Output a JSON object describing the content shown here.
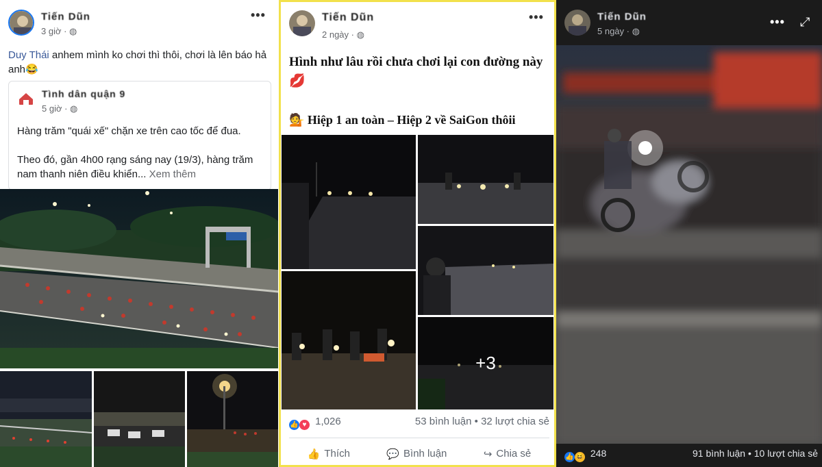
{
  "post1": {
    "author": "Tiến Dũn",
    "time": "3 giờ · ",
    "more": "•••",
    "mention": "Duy Thái",
    "text": " anhem mình ko chơi thì thôi, chơi là lên báo hả anh😂",
    "shared": {
      "author": "Tình dân quận 9",
      "time": "5 giờ · ",
      "headline": "Hàng trăm \"quái xế\" chặn xe trên cao tốc để đua.",
      "body": "Theo đó, gần 4h00 rạng sáng nay (19/3), hàng trăm nam thanh niên điều khiển...",
      "see_more": "Xem thêm"
    }
  },
  "post2": {
    "author": "Tiến Dũn",
    "time": "2 ngày · ",
    "more": "•••",
    "caption_line1": "Hình như lâu rồi chưa chơi lại con đường này 💋",
    "caption_line2": "💁 Hiệp 1 an toàn – Hiệp 2 về SaiGon thôii",
    "more_photos": "+3",
    "reaction_count": "1,026",
    "comments_shares": "53 bình luận • 32 lượt chia sẻ",
    "actions": {
      "like": "Thích",
      "comment": "Bình luận",
      "share": "Chia sẻ"
    }
  },
  "post3": {
    "author": "Tiến Dũn",
    "time": "5 ngày · ",
    "more": "•••",
    "expand": "⤢",
    "reaction_count": "248",
    "comments_shares": "91 bình luận • 10 lượt chia sẻ"
  },
  "colors": {
    "facebook_blue": "#1877f2",
    "mention": "#385898",
    "highlight_border": "#f2e14c",
    "dark_bg": "#1b1b1b"
  }
}
